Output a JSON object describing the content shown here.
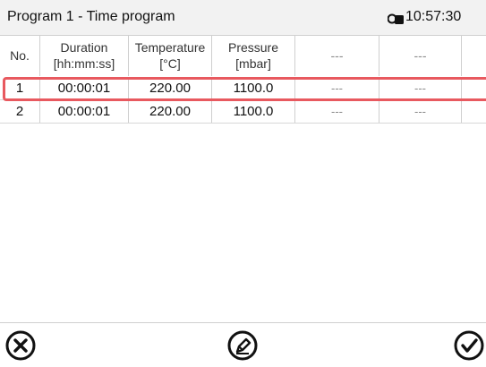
{
  "header": {
    "title": "Program 1 - Time program",
    "clock": "10:57:30",
    "lock_icon": "lock-icon"
  },
  "table": {
    "columns": [
      {
        "line1": "No.",
        "line2": ""
      },
      {
        "line1": "Duration",
        "line2": "[hh:mm:ss]"
      },
      {
        "line1": "Temperature",
        "line2": "[°C]"
      },
      {
        "line1": "Pressure",
        "line2": "[mbar]"
      },
      {
        "line1": "---",
        "line2": ""
      },
      {
        "line1": "---",
        "line2": ""
      }
    ],
    "rows": [
      {
        "no": "1",
        "duration": "00:00:01",
        "temperature": "220.00",
        "pressure": "1100.0",
        "c5": "---",
        "c6": "---"
      },
      {
        "no": "2",
        "duration": "00:00:01",
        "temperature": "220.00",
        "pressure": "1100.0",
        "c5": "---",
        "c6": "---"
      }
    ],
    "selected_row": 1
  },
  "footer": {
    "cancel_icon": "cancel-icon",
    "edit_icon": "edit-icon",
    "confirm_icon": "confirm-icon"
  },
  "colors": {
    "selection": "#e8595f"
  }
}
